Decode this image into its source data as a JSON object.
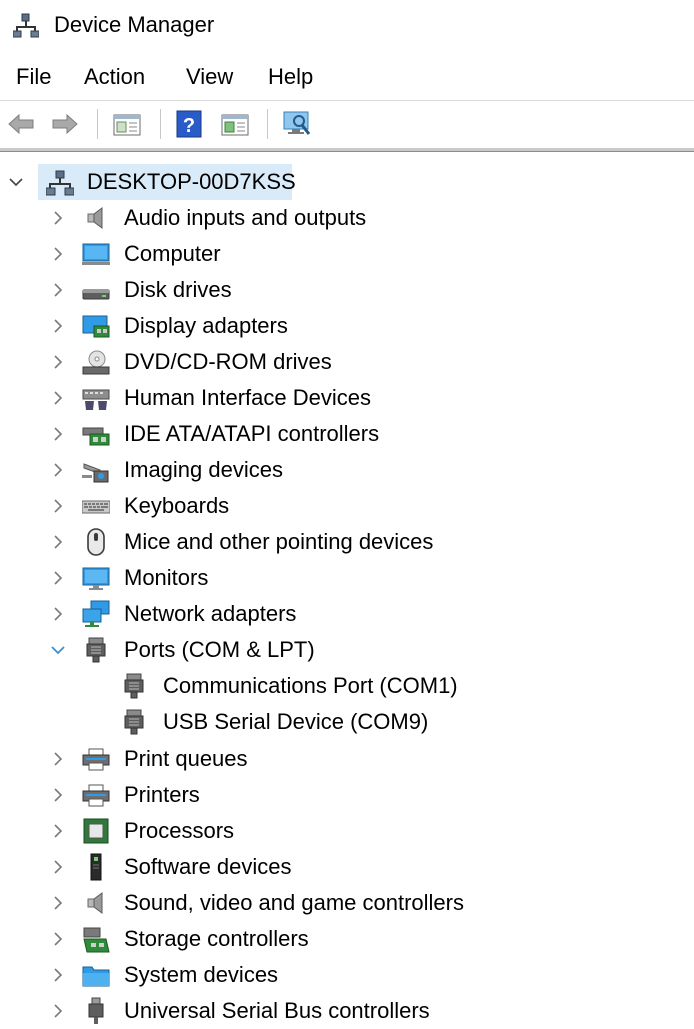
{
  "window": {
    "title": "Device Manager",
    "app_icon": "device-manager-icon"
  },
  "menu": [
    "File",
    "Action",
    "View",
    "Help"
  ],
  "toolbar": [
    "back-arrow-icon",
    "forward-arrow-icon",
    "properties-pane-icon",
    "help-icon",
    "show-hide-pane-icon",
    "scan-hardware-icon"
  ],
  "tree": {
    "root": "DESKTOP-00D7KSS",
    "categories": [
      {
        "label": "Audio inputs and outputs",
        "icon": "speaker-icon"
      },
      {
        "label": "Computer",
        "icon": "computer-icon"
      },
      {
        "label": "Disk drives",
        "icon": "disk-drive-icon"
      },
      {
        "label": "Display adapters",
        "icon": "display-adapter-icon"
      },
      {
        "label": "DVD/CD-ROM drives",
        "icon": "dvd-drive-icon"
      },
      {
        "label": "Human Interface Devices",
        "icon": "hid-icon"
      },
      {
        "label": "IDE ATA/ATAPI controllers",
        "icon": "ide-controller-icon"
      },
      {
        "label": "Imaging devices",
        "icon": "camera-icon"
      },
      {
        "label": "Keyboards",
        "icon": "keyboard-icon"
      },
      {
        "label": "Mice and other pointing devices",
        "icon": "mouse-icon"
      },
      {
        "label": "Monitors",
        "icon": "monitor-icon"
      },
      {
        "label": "Network adapters",
        "icon": "network-adapter-icon"
      },
      {
        "label": "Ports (COM & LPT)",
        "icon": "port-icon",
        "expanded": true,
        "children": [
          "Communications Port (COM1)",
          "USB Serial Device (COM9)"
        ]
      },
      {
        "label": "Print queues",
        "icon": "printer-icon"
      },
      {
        "label": "Printers",
        "icon": "printer-icon"
      },
      {
        "label": "Processors",
        "icon": "processor-icon"
      },
      {
        "label": "Software devices",
        "icon": "software-device-icon"
      },
      {
        "label": "Sound, video and game controllers",
        "icon": "speaker-icon"
      },
      {
        "label": "Storage controllers",
        "icon": "storage-controller-icon"
      },
      {
        "label": "System devices",
        "icon": "system-folder-icon"
      },
      {
        "label": "Universal Serial Bus controllers",
        "icon": "usb-icon"
      }
    ]
  },
  "colors": {
    "selection": "#d9ebf9",
    "accent_chevron": "#3a8fd6",
    "chevron": "#7a7a7a"
  }
}
